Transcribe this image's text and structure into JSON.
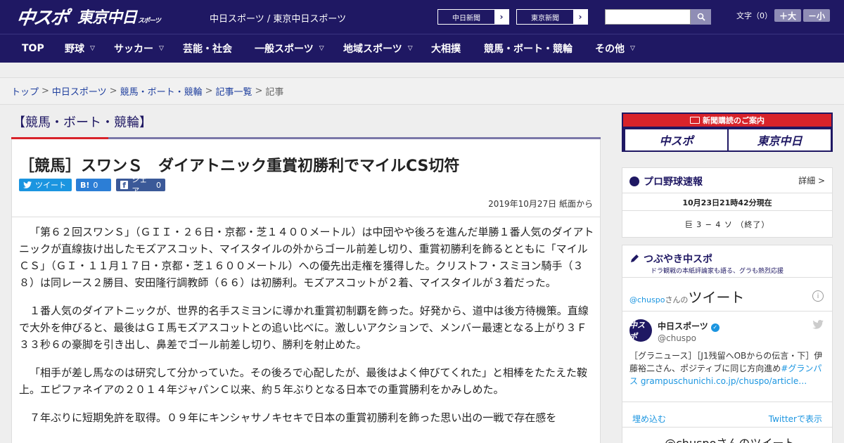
{
  "header": {
    "logo_chuspo": "中スポ",
    "logo_tokyo": "東京中日",
    "logo_tokyo_small": "スポーツ",
    "site_name": "中日スポーツ / 東京中日スポーツ",
    "chunichi_btn": "中日新聞",
    "tokyo_btn": "東京新聞",
    "search_placeholder": "",
    "font_size_label": "文字（0）",
    "font_bigger": "＋大",
    "font_smaller": "－小"
  },
  "nav": {
    "items": [
      {
        "label": "TOP",
        "chev": ""
      },
      {
        "label": "野球",
        "chev": "▽"
      },
      {
        "label": "サッカー",
        "chev": "▽"
      },
      {
        "label": "芸能・社会",
        "chev": ""
      },
      {
        "label": "一般スポーツ",
        "chev": "▽"
      },
      {
        "label": "地域スポーツ",
        "chev": "▽"
      },
      {
        "label": "大相撲",
        "chev": ""
      },
      {
        "label": "競馬・ボート・競輪",
        "chev": ""
      },
      {
        "label": "その他",
        "chev": "▽"
      }
    ]
  },
  "breadcrumb": {
    "items": [
      "トップ",
      "中日スポーツ",
      "競馬・ボート・競輪",
      "記事一覧"
    ],
    "sep": ">",
    "current": "記事"
  },
  "section": {
    "title": "【競馬・ボート・競輪】"
  },
  "article": {
    "headline": "［競馬］スワンＳ　ダイアトニック重賞初勝利でマイルCS切符",
    "share_tweet": "ツイート",
    "share_hatena_icon": "B!",
    "share_hatena_count": "0",
    "share_fb": "シェア",
    "share_fb_count": "0",
    "date": "2019年10月27日 紙面から",
    "paragraphs": [
      "「第６２回スワンＳ」（ＧＩＩ・２６日・京都・芝１４００メートル）は中団やや後ろを進んだ単勝１番人気のダイアトニックが直線抜け出したモズアスコット、マイスタイルの外からゴール前差し切り、重賞初勝利を飾るとともに「マイルＣＳ」（ＧＩ・１１月１７日・京都・芝１６００メートル）への優先出走権を獲得した。クリストフ・スミヨン騎手（３８）は同レース２勝目、安田隆行調教師（６６）は初勝利。モズアスコットが２着、マイスタイルが３着だった。",
      "１番人気のダイアトニックが、世界的名手スミヨンに導かれ重賞初制覇を飾った。好発から、道中は後方待機策。直線で大外を伸びると、最後はＧＩ馬モズアスコットとの追い比べに。激しいアクションで、メンバー最速となる上がり３Ｆ３３秒６の豪脚を引き出し、鼻差でゴール前差し切り、勝利を射止めた。",
      "「相手が差し馬なのは研究して分かっていた。その後ろで心配したが、最後はよく伸びてくれた」と相棒をたたえた鞍上。エピファネイアの２０１４年ジャパンＣ以来、約５年ぶりとなる日本での重賞勝利をかみしめた。",
      "７年ぶりに短期免許を取得。０９年にキンシャサノキセキで日本の重賞初勝利を飾った思い出の一戦で存在感を"
    ]
  },
  "sidebar": {
    "banner_title": "新聞購読のご案内",
    "banner_chuspo": "中スポ",
    "banner_tokyo": "東京中日",
    "baseball": {
      "title": "プロ野球速報",
      "detail": "詳細 >",
      "time": "10月23日21時42分現在",
      "score": "巨 3 − 4 ソ （終了）"
    },
    "twitter": {
      "title": "つぶやき中スポ",
      "subtitle": "ドラ観戦の本紙評論家も語る、グラも熱烈応援",
      "header_handle": "@chuspo",
      "header_san": "さんの",
      "header_tweet": "ツイート",
      "info": "i",
      "avatar": "中スポ",
      "name": "中日スポーツ",
      "handle": "@chuspo",
      "text": "［グラニュース］［J1残留へOBからの伝言・下］伊藤裕二さん、ポジティブに同じ方向進め",
      "text_link": "#グランパス grampuschunichi.co.jp/chuspo/article…",
      "embed": "埋め込む",
      "view": "Twitterで表示",
      "bottom": "@chuspoさんのツイート"
    }
  },
  "colors": {
    "brand": "#1f1863",
    "accent": "#d8232a",
    "twitter": "#1b95e0",
    "facebook": "#3b5998"
  }
}
